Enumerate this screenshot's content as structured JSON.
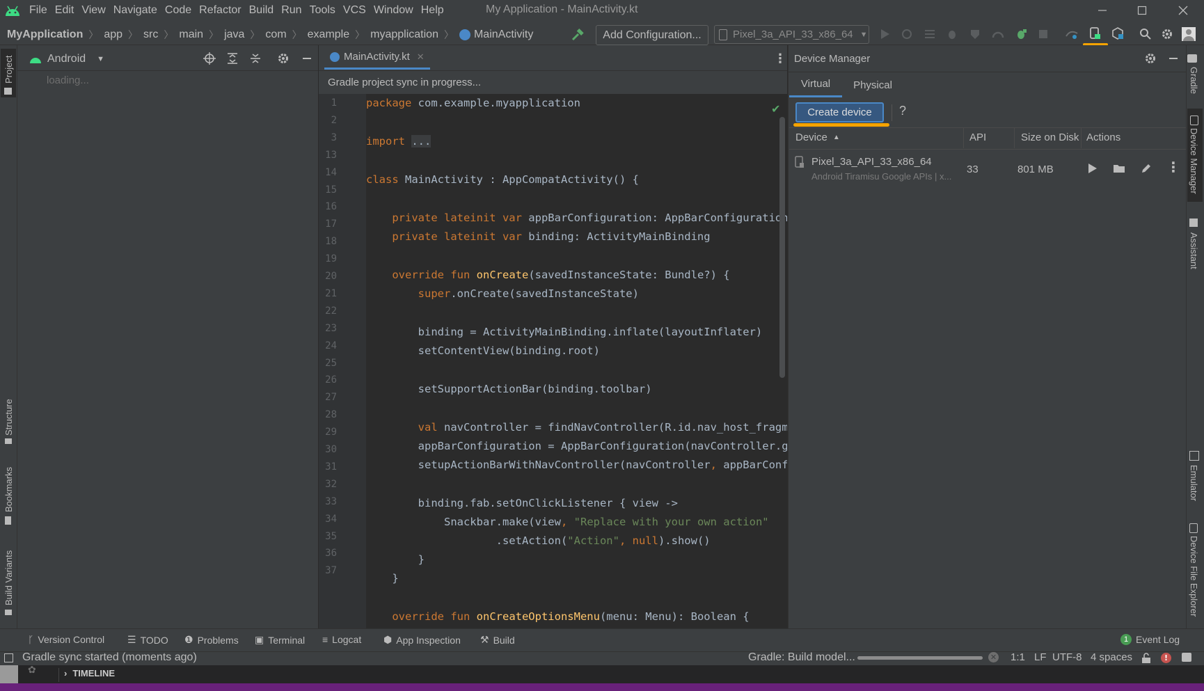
{
  "window": {
    "title": "My Application - MainActivity.kt",
    "menu": [
      "File",
      "Edit",
      "View",
      "Navigate",
      "Code",
      "Refactor",
      "Build",
      "Run",
      "Tools",
      "VCS",
      "Window",
      "Help"
    ]
  },
  "breadcrumb": [
    "MyApplication",
    "app",
    "src",
    "main",
    "java",
    "com",
    "example",
    "myapplication",
    "MainActivity"
  ],
  "toolbar": {
    "add_configuration": "Add Configuration...",
    "device_selector": "Pixel_3a_API_33_x86_64"
  },
  "project_panel": {
    "view_selector": "Android",
    "loading_text": "loading..."
  },
  "left_strip": {
    "tabs": [
      "Project",
      "Structure",
      "Bookmarks",
      "Build Variants"
    ]
  },
  "right_strip": {
    "tabs": [
      "Gradle",
      "Device Manager",
      "Assistant",
      "Emulator",
      "Device File Explorer"
    ]
  },
  "editor": {
    "tab_label": "MainActivity.kt",
    "sync_banner": "Gradle project sync in progress...",
    "line_numbers": [
      "1",
      "2",
      "3",
      "13",
      "14",
      "15",
      "16",
      "17",
      "18",
      "19",
      "20",
      "21",
      "22",
      "23",
      "24",
      "25",
      "26",
      "27",
      "28",
      "29",
      "30",
      "31",
      "32",
      "33",
      "34",
      "35",
      "36",
      "37"
    ]
  },
  "device_manager": {
    "title": "Device Manager",
    "tabs": [
      "Virtual",
      "Physical"
    ],
    "create_device": "Create device",
    "help": "?",
    "columns": {
      "device": "Device",
      "api": "API",
      "size": "Size on Disk",
      "actions": "Actions"
    },
    "devices": [
      {
        "name": "Pixel_3a_API_33_x86_64",
        "subtitle": "Android Tiramisu Google APIs | x...",
        "api": "33",
        "size": "801 MB"
      }
    ]
  },
  "tool_tabs": [
    "Version Control",
    "TODO",
    "Problems",
    "Terminal",
    "Logcat",
    "App Inspection",
    "Build"
  ],
  "event_log": {
    "badge": "1",
    "label": "Event Log"
  },
  "statusbar": {
    "message": "Gradle sync started (moments ago)",
    "task": "Gradle: Build model...",
    "position": "1:1",
    "line_sep": "LF",
    "encoding": "UTF-8",
    "indent": "4 spaces"
  },
  "timeline": {
    "label": "TIMELINE"
  },
  "colors": {
    "accent": "#4a88c7",
    "highlight": "#f5a300",
    "android_green": "#3ddc84",
    "keyword": "#cc7832",
    "function": "#ffc66d",
    "string": "#6a8759"
  }
}
